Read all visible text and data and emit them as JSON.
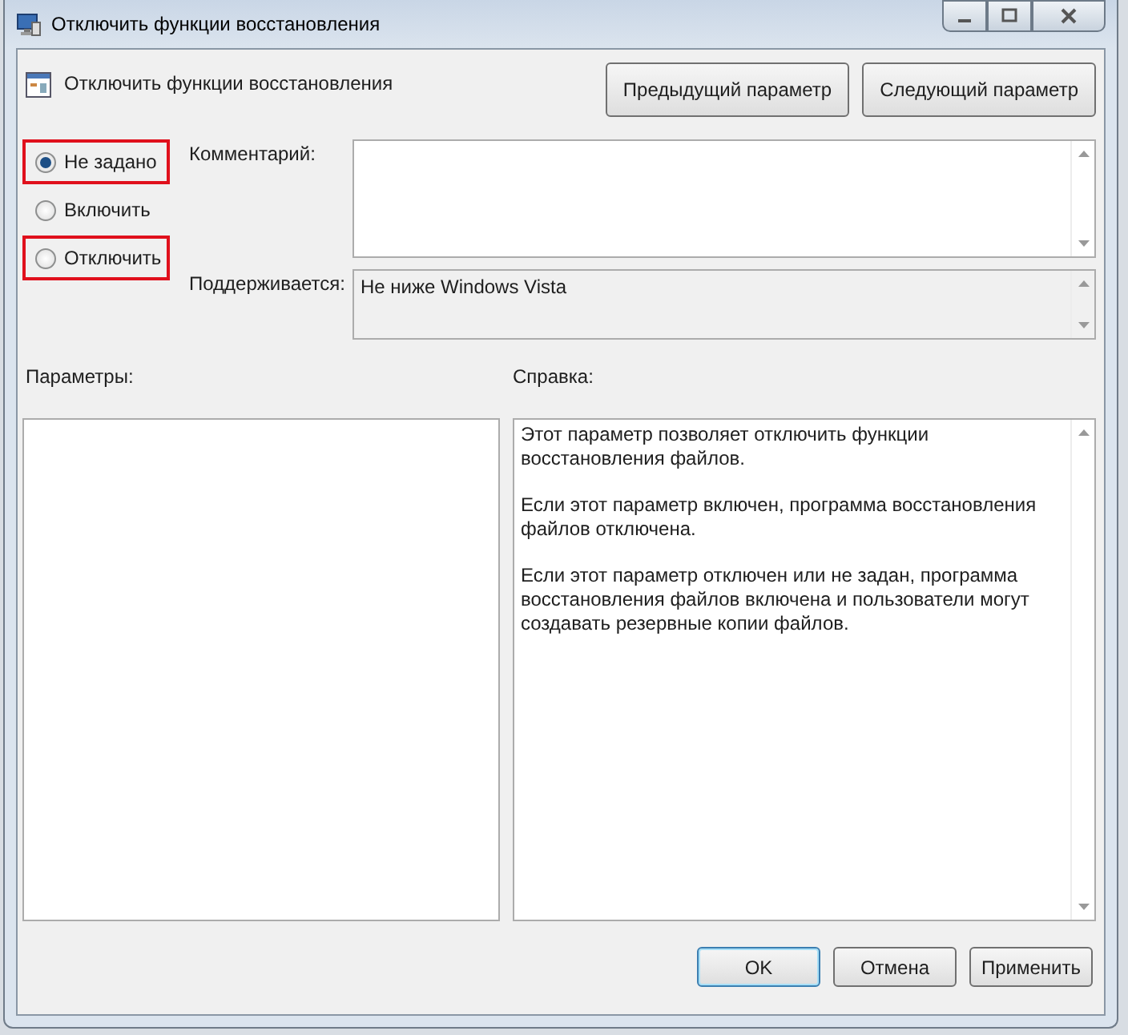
{
  "window": {
    "title": "Отключить функции восстановления"
  },
  "header": {
    "title": "Отключить функции восстановления"
  },
  "nav_buttons": [
    "Предыдущий параметр",
    "Следующий параметр"
  ],
  "options": [
    {
      "label": "Не задано",
      "selected": true,
      "highlighted": true
    },
    {
      "label": "Включить",
      "selected": false,
      "highlighted": false
    },
    {
      "label": "Отключить",
      "selected": false,
      "highlighted": true
    }
  ],
  "comment": {
    "label": "Комментарий:"
  },
  "supported": {
    "label": "Поддерживается:",
    "value": "Не ниже Windows Vista"
  },
  "options_panel": {
    "label": "Параметры:"
  },
  "help": {
    "label": "Справка:",
    "paragraphs": [
      "Этот параметр позволяет отключить функции восстановления файлов.",
      "Если этот параметр включен, программа восстановления файлов отключена.",
      "Если этот параметр отключен или не задан, программа восстановления файлов включена и пользователи могут создавать резервные копии файлов."
    ]
  },
  "buttons": [
    {
      "label": "OK",
      "default": true
    },
    {
      "label": "Отмена",
      "default": false
    },
    {
      "label": "Применить",
      "default": false
    }
  ]
}
